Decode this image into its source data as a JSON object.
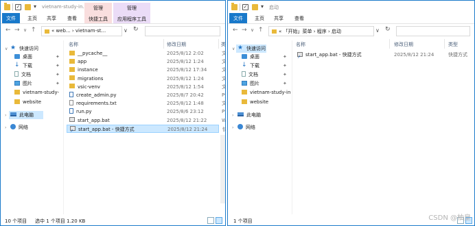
{
  "left_window": {
    "title": "vietnam-study-in...",
    "ribbon": {
      "file": "文件",
      "home": "主页",
      "share": "共享",
      "view": "查看",
      "ctx_manage_1": "管理",
      "ctx_tool_1": "快捷工具",
      "ctx_manage_2": "管理",
      "ctx_tool_2": "应用程序工具"
    },
    "address": "« web... › vietnam-st...",
    "nav": {
      "quick_access": "快速访问",
      "desktop": "桌面",
      "downloads": "下载",
      "documents": "文档",
      "pictures": "图片",
      "folder1": "vietnam-study-",
      "folder2": "website",
      "this_pc": "此电脑",
      "network": "网络"
    },
    "columns": {
      "name": "名称",
      "date": "修改日期",
      "type": "类"
    },
    "files": [
      {
        "name": "__pycache__",
        "date": "2025/8/12 2:02",
        "type": "文",
        "icon": "folder"
      },
      {
        "name": "app",
        "date": "2025/8/12 1:24",
        "type": "文",
        "icon": "folder"
      },
      {
        "name": "instance",
        "date": "2025/8/12 17:34",
        "type": "文",
        "icon": "folder"
      },
      {
        "name": "migrations",
        "date": "2025/8/12 1:24",
        "type": "文",
        "icon": "folder"
      },
      {
        "name": "vsic-venv",
        "date": "2025/8/12 1:54",
        "type": "文",
        "icon": "folder"
      },
      {
        "name": "create_admin.py",
        "date": "2025/8/7 20:42",
        "type": "Py",
        "icon": "py"
      },
      {
        "name": "requirements.txt",
        "date": "2025/8/12 1:48",
        "type": "文",
        "icon": "file"
      },
      {
        "name": "run.py",
        "date": "2025/8/6 23:12",
        "type": "Py",
        "icon": "py"
      },
      {
        "name": "start_app.bat",
        "date": "2025/8/12 21:22",
        "type": "W",
        "icon": "bat"
      },
      {
        "name": "start_app.bat - 快捷方式",
        "date": "2025/8/12 21:24",
        "type": "快",
        "icon": "lnk"
      }
    ],
    "status": {
      "count": "10 个项目",
      "selected": "选中 1 个项目  1.20 KB"
    }
  },
  "right_window": {
    "title": "启动",
    "ribbon": {
      "file": "文件",
      "home": "主页",
      "share": "共享",
      "view": "查看"
    },
    "address": "« 「开始」菜单 › 程序 › 启动",
    "nav": {
      "quick_access": "快速访问",
      "desktop": "桌面",
      "downloads": "下载",
      "documents": "文档",
      "pictures": "图片",
      "folder1": "vietnam-study-in-",
      "folder2": "website",
      "this_pc": "此电脑",
      "network": "网络"
    },
    "columns": {
      "name": "名称",
      "date": "修改日期",
      "type": "类型"
    },
    "files": [
      {
        "name": "start_app.bat - 快捷方式",
        "date": "2025/8/12 21:24",
        "type": "快捷方式",
        "icon": "lnk"
      }
    ],
    "status": {
      "count": "1 个项目"
    }
  },
  "watermark": "CSDN @柚皇"
}
